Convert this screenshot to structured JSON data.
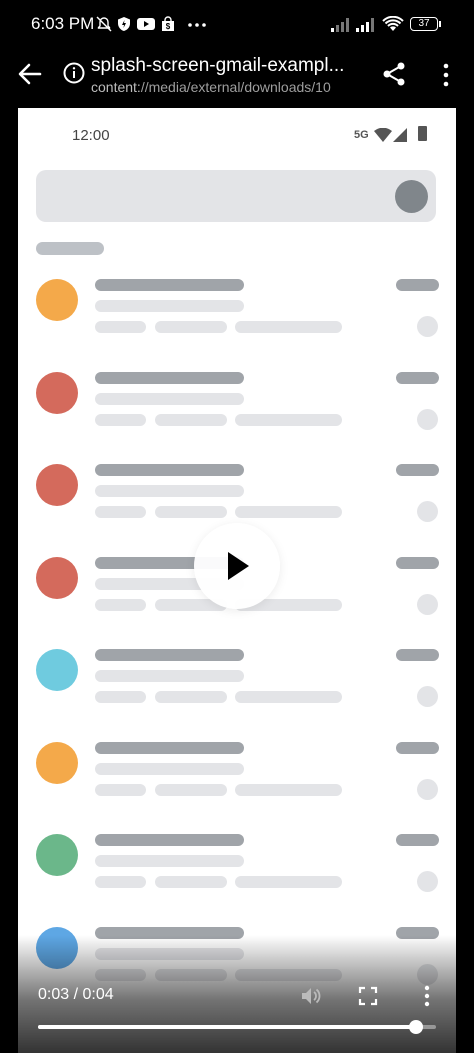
{
  "status_bar": {
    "time": "6:03 PM",
    "battery": "37"
  },
  "header": {
    "title": "splash-screen-gmail-exampl...",
    "path_scheme": "content:",
    "path_rest": "//media/external/downloads/10"
  },
  "video_frame": {
    "status_time": "12:00",
    "network": "5G",
    "avatar_colors": [
      "#f4a94a",
      "#d46a5c",
      "#d46a5c",
      "#d46a5c",
      "#6fcbdf",
      "#f4a94a",
      "#6bb78a",
      "#5ea7e4"
    ]
  },
  "player": {
    "timecode": "0:03 / 0:04",
    "progress": 0.95
  },
  "colors": {
    "background": "#000000",
    "video_bg": "#ffffff",
    "skeleton_dark": "#a0a4a9",
    "skeleton_light": "#e3e4e7"
  }
}
